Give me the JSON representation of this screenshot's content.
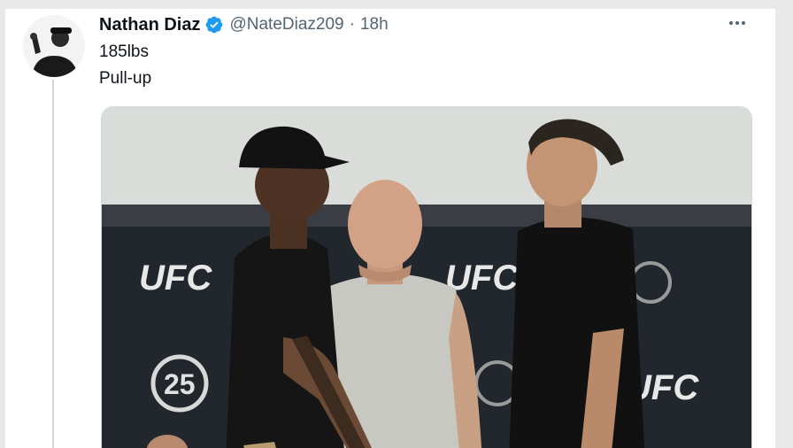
{
  "tweet": {
    "author_name": "Nathan Diaz",
    "handle": "@NateDiaz209",
    "separator": "·",
    "time": "18h",
    "lines": [
      "185lbs",
      "Pull-up"
    ],
    "verified": true,
    "media": {
      "banner_text": "UFC",
      "anniversary_text": "25",
      "description_icon": "photo-of-faceoff"
    }
  },
  "icons": {
    "verified": "verified-badge-icon",
    "more": "more-options-icon"
  },
  "colors": {
    "verified": "#1d9bf0",
    "name": "#0f1419",
    "secondary": "#536471",
    "banner": "#1f242b"
  }
}
